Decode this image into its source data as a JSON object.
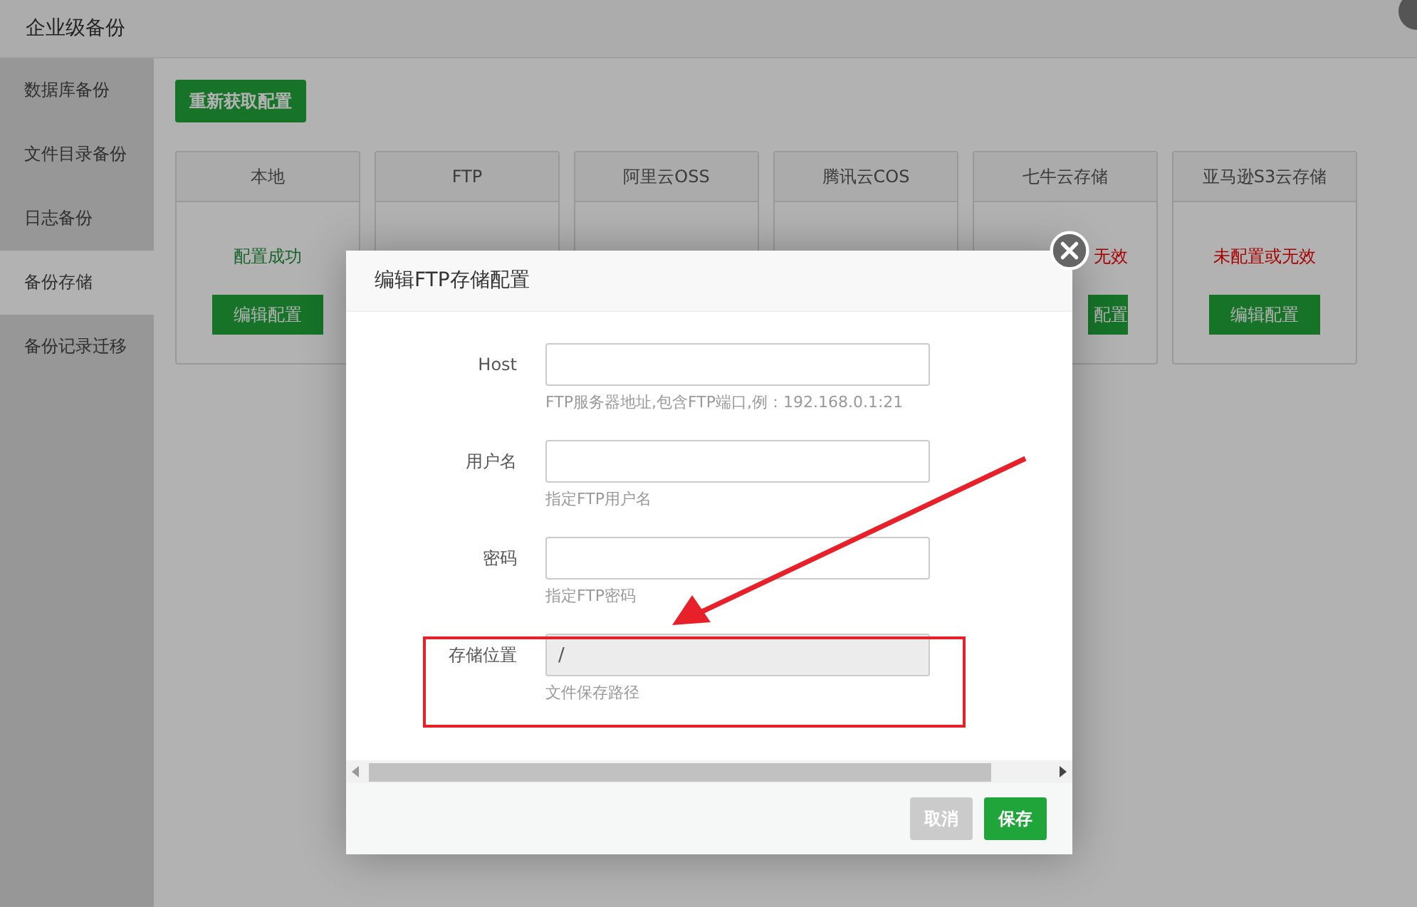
{
  "window": {
    "title": "企业级备份"
  },
  "sidebar": {
    "items": [
      {
        "label": "数据库备份",
        "selected": false
      },
      {
        "label": "文件目录备份",
        "selected": false
      },
      {
        "label": "日志备份",
        "selected": false
      },
      {
        "label": "备份存储",
        "selected": true
      },
      {
        "label": "备份记录迁移",
        "selected": false
      }
    ]
  },
  "refresh_button": "重新获取配置",
  "storage_cards": [
    {
      "title": "本地",
      "status": {
        "text": "配置成功",
        "ok": true
      },
      "edit_button": "编辑配置",
      "clipped": false
    },
    {
      "title": "FTP"
    },
    {
      "title": "阿里云OSS"
    },
    {
      "title": "腾讯云COS"
    },
    {
      "title": "七牛云存储",
      "status": {
        "text": "无效",
        "ok": false
      },
      "edit_button": "配置",
      "clipped": true
    },
    {
      "title": "亚马逊S3云存储",
      "status": {
        "text": "未配置或无效",
        "ok": false
      },
      "edit_button": "编辑配置",
      "clipped": false
    }
  ],
  "dialog": {
    "title": "编辑FTP存储配置",
    "fields": [
      {
        "label": "Host",
        "hint": "FTP服务器地址,包含FTP端口,例：192.168.0.1:21",
        "readonly": false
      },
      {
        "label": "用户名",
        "hint": "指定FTP用户名",
        "readonly": false
      },
      {
        "label": "密码",
        "hint": "指定FTP密码",
        "readonly": false
      },
      {
        "label": "存储位置",
        "value": "/",
        "hint": "文件保存路径",
        "readonly": true
      }
    ],
    "buttons": [
      {
        "label": "取消",
        "kind": "secondary"
      },
      {
        "label": "保存",
        "kind": "primary"
      }
    ]
  }
}
